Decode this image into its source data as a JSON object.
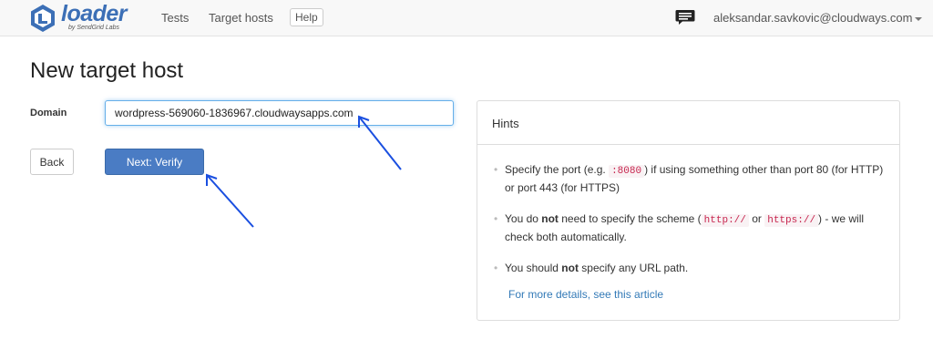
{
  "brand": {
    "name": "loader",
    "subtitle": "by SendGrid Labs"
  },
  "nav": {
    "tests": "Tests",
    "target_hosts": "Target hosts",
    "help": "Help",
    "user_email": "aleksandar.savkovic@cloudways.com"
  },
  "page": {
    "title": "New target host",
    "domain_label": "Domain",
    "domain_value": "wordpress-569060-1836967.cloudwaysapps.com",
    "back_button": "Back",
    "next_button": "Next: Verify"
  },
  "hints": {
    "title": "Hints",
    "port": {
      "prefix": "Specify the port (e.g. ",
      "code": ":8080",
      "suffix": ") if using something other than port 80 (for HTTP) or port 443 (for HTTPS)"
    },
    "scheme": {
      "prefix": "You do ",
      "emphasis": "not",
      "middle": " need to specify the scheme (",
      "code1": "http://",
      "or": " or ",
      "code2": "https://",
      "suffix": ") - we will check both automatically."
    },
    "path": {
      "prefix": "You should ",
      "emphasis": "not",
      "suffix": " specify any URL path."
    },
    "link": "For more details, see this article"
  },
  "colors": {
    "brand": "#3c6fb6",
    "primary_button": "#4a7cc4",
    "annotation_arrow": "#1a4fe0",
    "code_text": "#c7254e"
  },
  "icons": {
    "brand": "loader-logo-icon",
    "chat": "chat-icon",
    "user_menu": "caret-down-icon"
  }
}
